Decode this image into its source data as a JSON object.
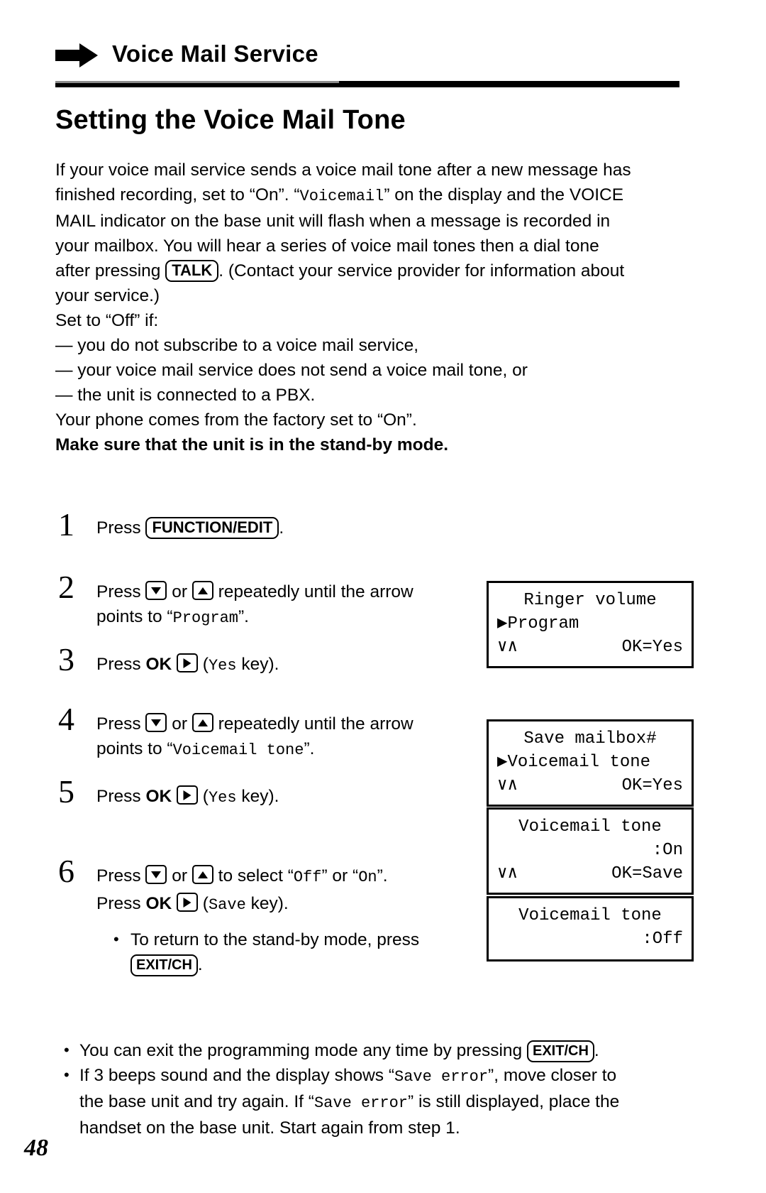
{
  "header": {
    "icon": "right-arrow-icon",
    "title": "Voice Mail Service"
  },
  "section": {
    "title": "Setting the Voice Mail Tone"
  },
  "intro": {
    "line1_a": "If your voice mail service sends a voice mail tone after a new message has",
    "line2_a": "finished recording, set to “On”. “",
    "line2_mono": "Voicemail",
    "line2_b": "” on the display and the VOICE",
    "line3": "MAIL indicator on the base unit will flash when a message is recorded in",
    "line4": "your mailbox. You will hear a series of voice mail tones then a dial tone",
    "line5_a": "after pressing ",
    "line5_key": "TALK",
    "line5_b": ". (Contact your service provider for information about",
    "line6": "your service.)",
    "line7": "Set to “Off” if:",
    "line8": "— you do not subscribe to a voice mail service,",
    "line9": "— your voice mail service does not send a voice mail tone, or",
    "line10": "— the unit is connected to a PBX.",
    "line11": "Your phone comes from the factory set to “On”.",
    "line12_bold": "Make sure that the unit is in the stand-by mode."
  },
  "steps": [
    {
      "num": "1",
      "text_a": "Press ",
      "key": "FUNCTION/EDIT",
      "text_b": "."
    },
    {
      "num": "2",
      "text_a": "Press ",
      "key_down": "down-arrow-key",
      "text_b": " or ",
      "key_up": "up-arrow-key",
      "text_c": " repeatedly until the arrow",
      "text_d": "points to “",
      "mono": "Program",
      "text_e": "”."
    },
    {
      "num": "3",
      "text_a": "Press ",
      "bold": "OK",
      "key_right": "right-arrow-key",
      "text_b": " (",
      "mono": "Yes",
      "text_c": " key)."
    },
    {
      "num": "4",
      "text_a": "Press ",
      "key_down": "down-arrow-key",
      "text_b": " or ",
      "key_up": "up-arrow-key",
      "text_c": " repeatedly until the arrow",
      "text_d": "points to “",
      "mono": "Voicemail tone",
      "text_e": "”."
    },
    {
      "num": "5",
      "text_a": "Press ",
      "bold": "OK",
      "key_right": "right-arrow-key",
      "text_b": " (",
      "mono": "Yes",
      "text_c": " key)."
    },
    {
      "num": "6",
      "line1_a": "Press ",
      "key_down": "down-arrow-key",
      "line1_b": " or ",
      "key_up": "up-arrow-key",
      "line1_c": " to select “",
      "line1_mono1": "Off",
      "line1_d": "” or “",
      "line1_mono2": "On",
      "line1_e": "”.",
      "line2_a": "Press ",
      "line2_bold": "OK",
      "key_right": "right-arrow-key",
      "line2_b": " (",
      "line2_mono": "Save",
      "line2_c": " key).",
      "note_a": "To return to the stand-by mode, press",
      "note_key": "EXIT/CH",
      "note_b": "."
    }
  ],
  "displays": [
    {
      "name": "display-program",
      "row1": "Ringer volume",
      "row2": "▶Program",
      "row3_left": "∨∧",
      "row3_right": "OK=Yes"
    },
    {
      "name": "display-voicemail-tone-menu",
      "row1": "Save mailbox#",
      "row2": "▶Voicemail tone",
      "row3_left": "∨∧",
      "row3_right": "OK=Yes"
    },
    {
      "name": "display-voicemail-tone-on",
      "row1": "Voicemail tone",
      "row2": ":On",
      "row3_left": "∨∧",
      "row3_right": "OK=Save"
    },
    {
      "name": "display-voicemail-tone-off",
      "row1": "Voicemail tone",
      "row2": ":Off"
    }
  ],
  "bullets": {
    "b1_a": "You can exit the programming mode any time by pressing ",
    "b1_key": "EXIT/CH",
    "b1_b": ".",
    "b2_a": "If 3 beeps sound and the display shows “",
    "b2_mono1": "Save error",
    "b2_b": "”, move closer to",
    "b2_c": "the base unit and try again. If “",
    "b2_mono2": "Save error",
    "b2_d": "” is still displayed, place the",
    "b2_e": "handset on the base unit. Start again from step 1."
  },
  "footer": {
    "page_number": "48"
  }
}
